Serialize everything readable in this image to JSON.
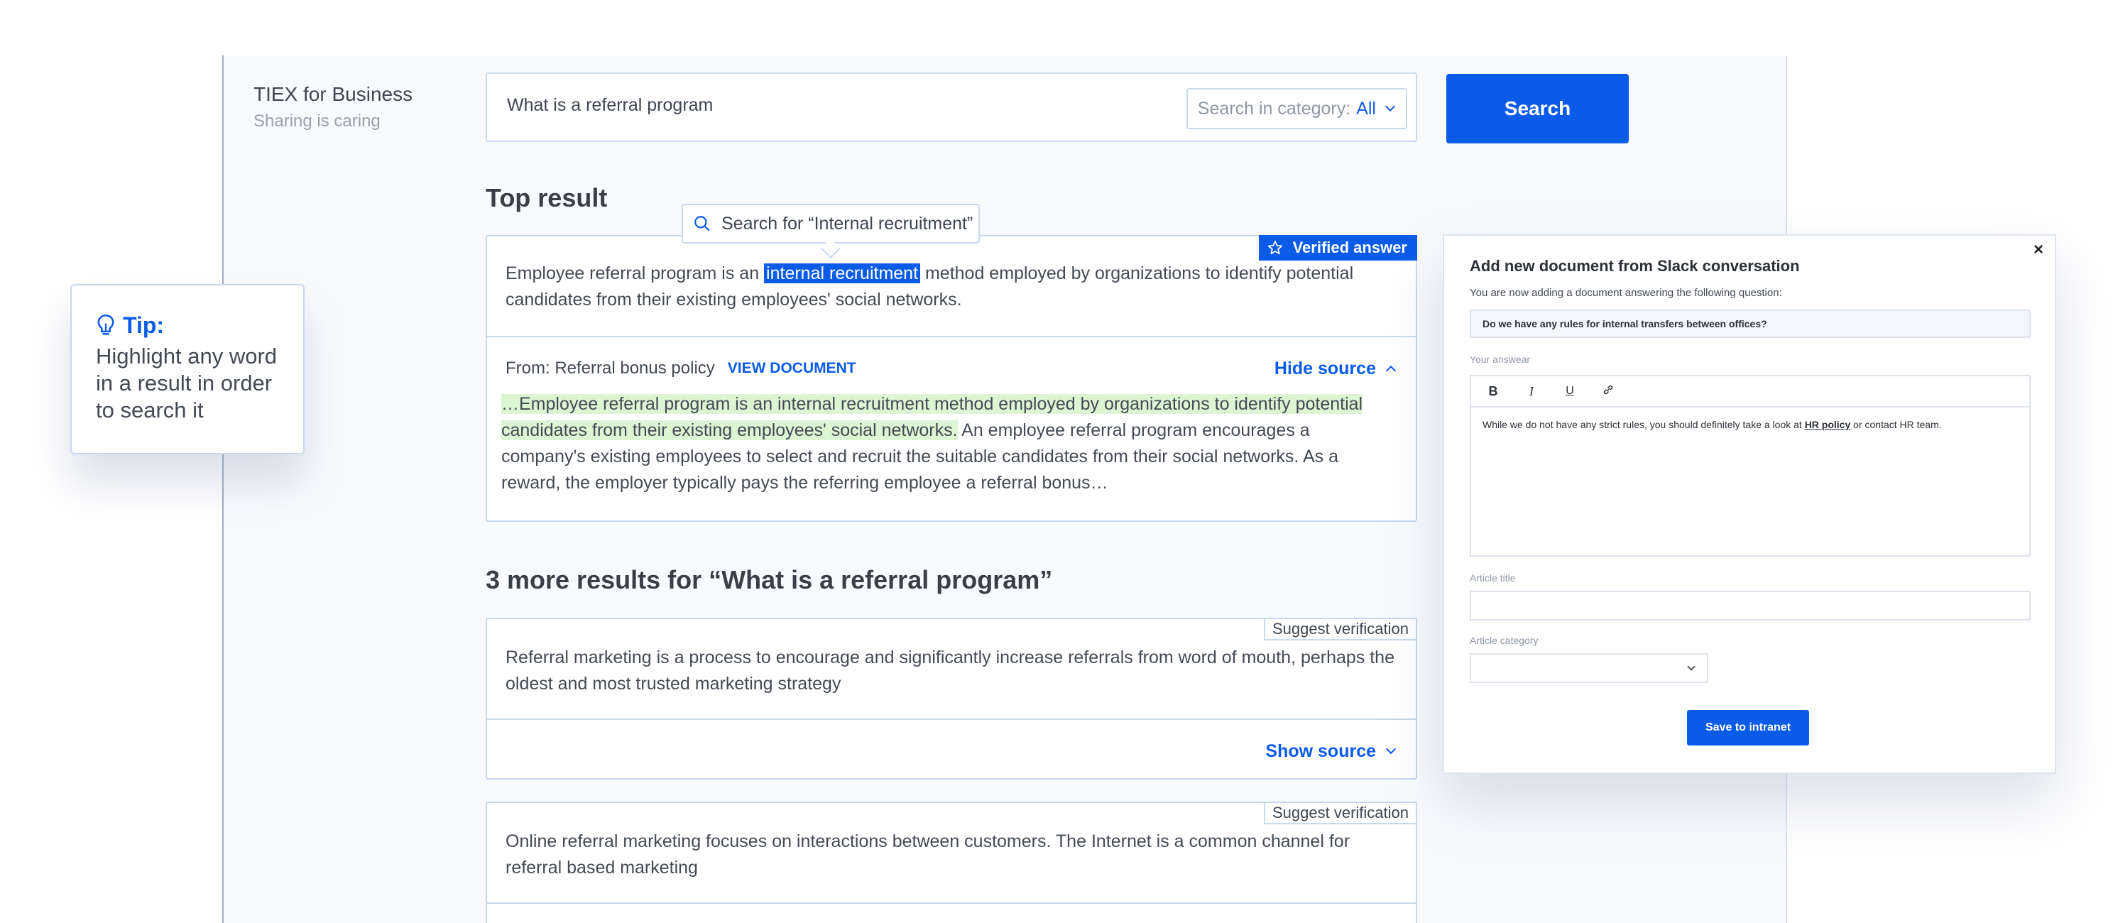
{
  "brand": {
    "name": "TIEX for Business",
    "tagline": "Sharing is caring"
  },
  "search": {
    "query": "What is a referral program",
    "category_label": "Search in category:",
    "category_value": "All",
    "button_label": "Search"
  },
  "top_result": {
    "heading": "Top result",
    "tooltip": "Search for “Internal recruitment”",
    "badge": "Verified answer",
    "text_before": "Employee referral program is an ",
    "text_selected": "internal recruitment",
    "text_after": " method employed by organizations to identify potential candidates from their existing employees' social networks.",
    "source_label": "From: Referral bonus policy",
    "view_document": "VIEW DOCUMENT",
    "hide_source": "Hide source",
    "source_highlight": "…Employee referral program is an internal recruitment method employed by organizations to identify potential candidates from their existing employees' social networks.",
    "source_rest": " An employee referral program encourages a company's existing employees to select and recruit the suitable candidates from their social networks. As a reward, the employer typically pays the referring employee a referral bonus…"
  },
  "more_results": {
    "heading": "3 more results for “What is a referral program”",
    "items": [
      {
        "badge": "Suggest verification",
        "text": "Referral marketing is a process to encourage and significantly increase referrals from word of mouth, perhaps the oldest and most trusted marketing strategy",
        "show_source": "Show source"
      },
      {
        "badge": "Suggest verification",
        "text": "Online referral marketing focuses on interactions between customers. The Internet is a common channel for referral based marketing"
      }
    ]
  },
  "tip": {
    "title": "Tip:",
    "body": "Highlight any word in a result in order to search it"
  },
  "modal": {
    "close": "×",
    "title": "Add new document from Slack conversation",
    "subtitle": "You are now adding a document answering the following question:",
    "question": "Do we have any rules for internal transfers between offices?",
    "answer_label": "Your answear",
    "toolbar": {
      "bold": "B",
      "italic": "I",
      "underline": "U",
      "link": "🔗"
    },
    "answer_before": "While we do not have any strict rules, you should definitely take a look at ",
    "answer_link": "HR policy",
    "answer_after": " or contact HR team.",
    "article_title_label": "Article title",
    "article_title_value": "",
    "article_category_label": "Article category",
    "article_category_value": "",
    "save_button": "Save to intranet"
  },
  "colors": {
    "accent": "#0a5ce8",
    "highlight_green": "#dcf5d3",
    "border": "#c8d8ee"
  }
}
